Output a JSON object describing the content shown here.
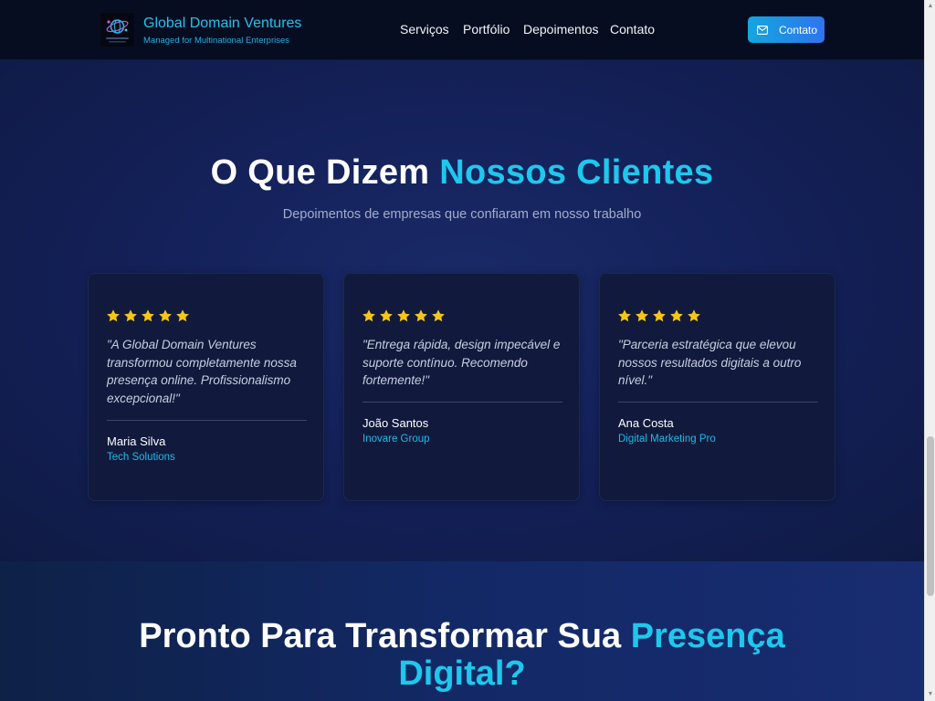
{
  "header": {
    "brand_name": "Global Domain Ventures",
    "brand_tagline": "Managed for Multinational Enterprises",
    "nav": [
      "Serviços",
      "Portfólio",
      "Depoimentos",
      "Contato"
    ],
    "cta_label": "Contato"
  },
  "testimonials": {
    "title_plain": "O Que Dizem ",
    "title_accent": "Nossos Clientes",
    "subtitle": "Depoimentos de empresas que confiaram em nosso trabalho",
    "cards": [
      {
        "rating": 5,
        "quote": "\"A Global Domain Ventures transformou completamente nossa presença online. Profissionalismo excepcional!\"",
        "author": "Maria Silva",
        "company": "Tech Solutions"
      },
      {
        "rating": 5,
        "quote": "\"Entrega rápida, design impecável e suporte contínuo. Recomendo fortemente!\"",
        "author": "João Santos",
        "company": "Inovare Group"
      },
      {
        "rating": 5,
        "quote": "\"Parceria estratégica que elevou nossos resultados digitais a outro nível.\"",
        "author": "Ana Costa",
        "company": "Digital Marketing Pro"
      }
    ]
  },
  "cta": {
    "title_plain": "Pronto Para Transformar Sua ",
    "title_accent_1": "Presença",
    "title_accent_2": "Digital?"
  },
  "colors": {
    "accent": "#1ec8ec",
    "star": "#f5c518",
    "header_bg": "#070d21",
    "button_gradient_start": "#14a6de",
    "button_gradient_end": "#2f74ee"
  },
  "icons": [
    "globe-logo-icon",
    "mail-icon",
    "star-icon"
  ]
}
